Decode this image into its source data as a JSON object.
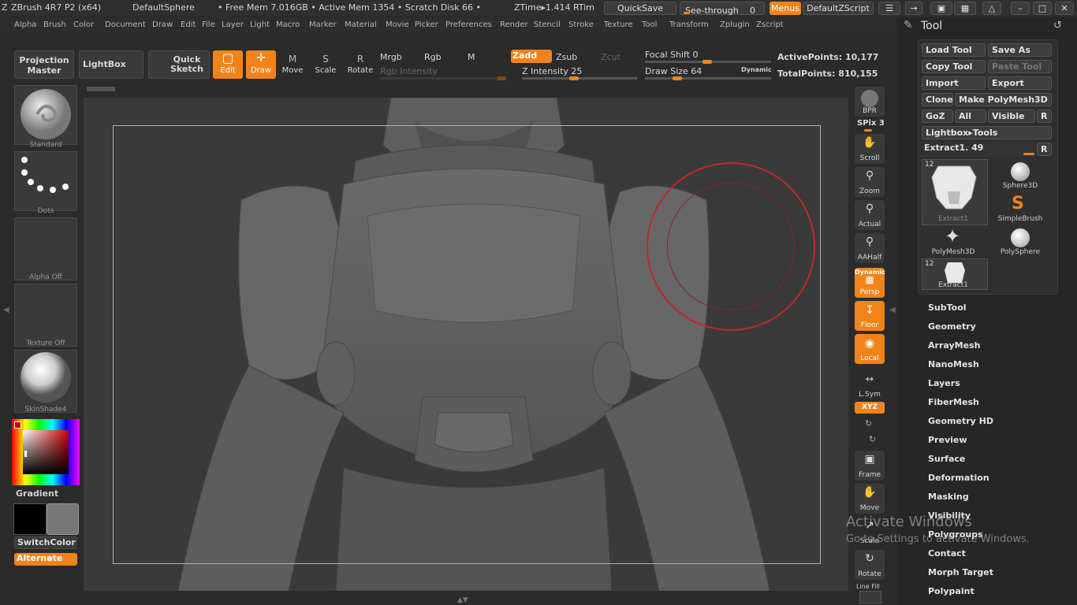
{
  "titlebar": {
    "app": "ZBrush 4R7 P2 (x64)",
    "doc": "DefaultSphere",
    "stats": "• Free Mem 7.016GB • Active Mem 1354 • Scratch Disk 66 •",
    "ztime": "ZTime▸1.414 RTim",
    "quicksave": "QuickSave",
    "seethrough": "See-through",
    "seethrough_value": "0",
    "menus": "Menus",
    "script": "DefaultZScript"
  },
  "menubar": [
    "Alpha",
    "Brush",
    "Color",
    "Document",
    "Draw",
    "Edit",
    "File",
    "Layer",
    "Light",
    "Macro",
    "Marker",
    "Material",
    "Movie",
    "Picker",
    "Preferences",
    "Render",
    "Stencil",
    "Stroke",
    "Texture",
    "Tool",
    "Transform",
    "Zplugin",
    "Zscript"
  ],
  "toolbar": {
    "projection_master": [
      "Projection",
      "Master"
    ],
    "lightbox": "LightBox",
    "quick_sketch": [
      "Quick",
      "Sketch"
    ],
    "edit": "Edit",
    "draw": "Draw",
    "move": "Move",
    "scale": "Scale",
    "rotate": "Rotate",
    "mrgb": "Mrgb",
    "rgb": "Rgb",
    "m": "M",
    "zadd": "Zadd",
    "zsub": "Zsub",
    "zcut": "Zcut",
    "rgb_intensity": "Rgb Intensity",
    "z_intensity": "Z Intensity 25",
    "focal_shift": "Focal Shift 0",
    "draw_size": "Draw Size 64",
    "dynamic": "Dynamic",
    "active_points": "ActivePoints: 10,177",
    "total_points": "TotalPoints: 810,155"
  },
  "leftshelf": {
    "brush": "Standard",
    "stroke": "Dots",
    "alpha": "Alpha Off",
    "texture": "Texture Off",
    "material": "SkinShade4",
    "gradient": "Gradient",
    "switchcolor": "SwitchColor",
    "alternate": "Alternate"
  },
  "rightshelf": [
    {
      "label": "BPR",
      "orange": false
    },
    {
      "label": "Scroll",
      "orange": false
    },
    {
      "label": "Zoom",
      "orange": false
    },
    {
      "label": "Actual",
      "orange": false
    },
    {
      "label": "AAHalf",
      "orange": false
    },
    {
      "label": "Persp",
      "orange": true
    },
    {
      "label": "Floor",
      "orange": true
    },
    {
      "label": "Local",
      "orange": true
    },
    {
      "label": "L.Sym",
      "orange": false
    },
    {
      "label": "Frame",
      "orange": false
    },
    {
      "label": "Move",
      "orange": false
    },
    {
      "label": "Scale",
      "orange": false
    },
    {
      "label": "Rotate",
      "orange": false
    }
  ],
  "spix": "SPix 3",
  "dynamic_label": "Dynamic",
  "xyz": "XYZ",
  "line_fill": "Line Fill",
  "toolpanel": {
    "title": "Tool",
    "load_tool": "Load Tool",
    "save_as": "Save As",
    "copy_tool": "Copy Tool",
    "paste_tool": "Paste Tool",
    "import": "Import",
    "export": "Export",
    "clone": "Clone",
    "make_polymesh": "Make PolyMesh3D",
    "goz": "GoZ",
    "all": "All",
    "visible": "Visible",
    "r": "R",
    "lightbox_tools": "Lightbox▸Tools",
    "extract_slider": "Extract1. 49",
    "count_12": "12",
    "tools": [
      "Extract1",
      "Sphere3D",
      "SimpleBrush",
      "PolyMesh3D",
      "PolySphere",
      "Extract1"
    ],
    "sections": [
      "SubTool",
      "Geometry",
      "ArrayMesh",
      "NanoMesh",
      "Layers",
      "FiberMesh",
      "Geometry HD",
      "Preview",
      "Surface",
      "Deformation",
      "Masking",
      "Visibility",
      "Polygroups",
      "Contact",
      "Morph Target",
      "Polypaint"
    ]
  },
  "watermark": {
    "line1": "Activate Windows",
    "line2": "Go to Settings to activate Windows."
  },
  "colors": {
    "accent": "#f0841a",
    "panel": "#2b2b2b",
    "canvas": "#3a3a3a",
    "brush_circle": "#c0282a"
  }
}
